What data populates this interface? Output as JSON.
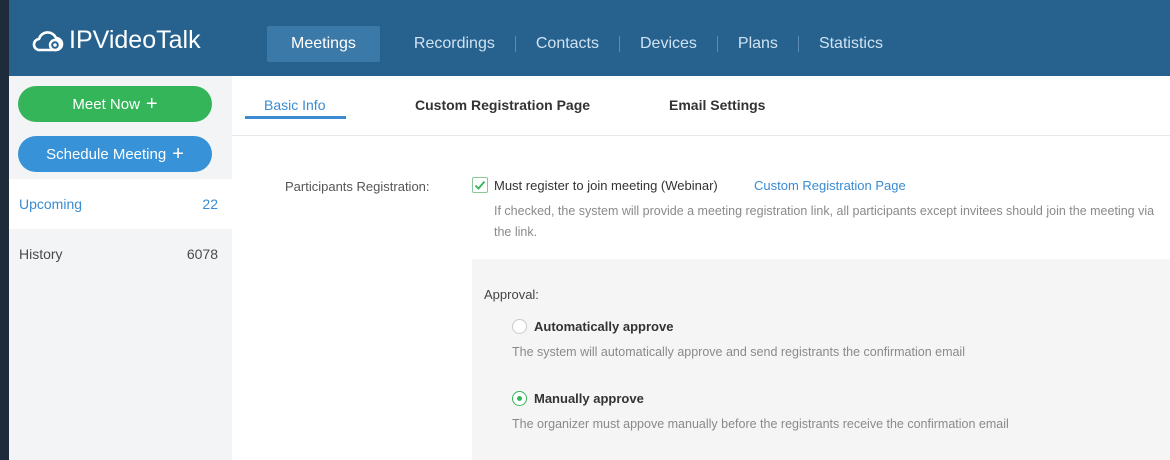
{
  "app": {
    "logo_text": "IPVideoTalk",
    "brand_color": "#27628f"
  },
  "nav": {
    "items": [
      {
        "label": "Meetings",
        "active": true
      },
      {
        "label": "Recordings",
        "active": false
      },
      {
        "label": "Contacts",
        "active": false
      },
      {
        "label": "Devices",
        "active": false
      },
      {
        "label": "Plans",
        "active": false
      },
      {
        "label": "Statistics",
        "active": false
      }
    ]
  },
  "sidebar": {
    "meet_now": "Meet Now",
    "schedule": "Schedule Meeting",
    "plus": "+",
    "items": [
      {
        "label": "Upcoming",
        "count": "22"
      },
      {
        "label": "History",
        "count": "6078"
      }
    ]
  },
  "tabs": [
    {
      "label": "Basic Info",
      "active": true
    },
    {
      "label": "Custom Registration Page",
      "active": false
    },
    {
      "label": "Email Settings",
      "active": false
    }
  ],
  "registration": {
    "label": "Participants Registration:",
    "checkbox_label": "Must register to join meeting (Webinar)",
    "checked": true,
    "link": "Custom Registration Page",
    "hint": "If checked, the system will provide a meeting registration link, all participants except invitees should join the meeting via the link."
  },
  "approval": {
    "label": "Approval:",
    "options": [
      {
        "title": "Automatically approve",
        "desc": "The system will automatically approve and send registrants the confirmation email",
        "selected": false
      },
      {
        "title": "Manually approve",
        "desc": "The organizer must appove manually before the registrants receive the confirmation email",
        "selected": true
      }
    ]
  },
  "colors": {
    "green": "#34b559",
    "blue": "#3792d8",
    "link": "#3a8bd1"
  }
}
